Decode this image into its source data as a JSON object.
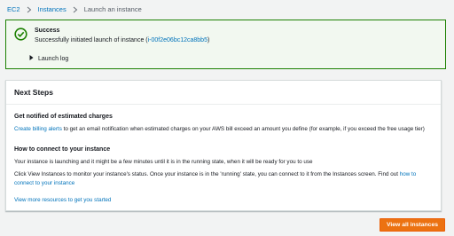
{
  "breadcrumb": {
    "items": [
      "EC2",
      "Instances",
      "Launch an instance"
    ]
  },
  "success": {
    "title": "Success",
    "message_prefix": "Successfully initiated launch of instance (",
    "instance_id": "i-00f2e06bc12ca8bb5",
    "message_suffix": ")",
    "launch_log": "Launch log"
  },
  "next_steps": {
    "title": "Next Steps",
    "section1_title": "Get notified of estimated charges",
    "section1_link": "Create billing alerts",
    "section1_text": " to get an email notification when estimated charges on your AWS bill exceed an amount you define (for example, if you exceed the free usage tier)",
    "section2_title": "How to connect to your instance",
    "section2_p1": "Your instance is launching and it might be a few minutes until it is in the running state, when it will be ready for you to use",
    "section2_p2": "Click View Instances to monitor your instance's status. Once your instance is in the 'running' state, you can connect to it from the Instances screen. Find out ",
    "section2_link": "how to connect to your instance",
    "more_resources": "View more resources to get you started"
  },
  "cta": {
    "label": "View all instances"
  },
  "colors": {
    "accent": "#0073bb",
    "success_border": "#1d8102",
    "success_bg": "#f2f8f0",
    "primary_button": "#ec7211"
  }
}
